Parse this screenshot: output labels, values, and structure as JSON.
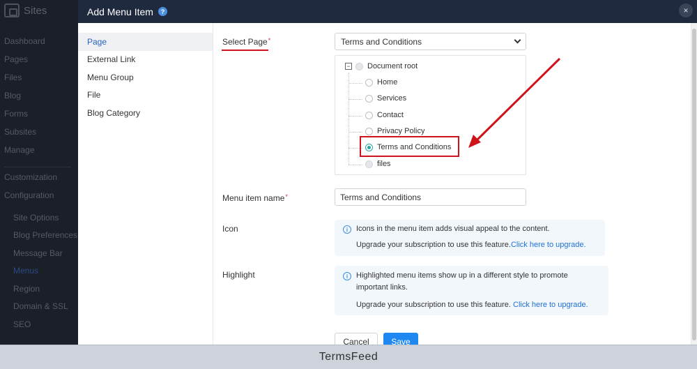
{
  "background": {
    "app_title": "Sites",
    "nav_items": [
      "Dashboard",
      "Pages",
      "Files",
      "Blog",
      "Forms",
      "Subsites",
      "Manage"
    ],
    "section_items": [
      "Customization",
      "Configuration"
    ],
    "sub_items": [
      "Site Options",
      "Blog Preferences",
      "Message Bar",
      "Menus",
      "Region",
      "Domain & SSL",
      "SEO"
    ],
    "active_sub_item": "Menus"
  },
  "modal": {
    "title": "Add Menu Item",
    "help_icon": "?",
    "close_icon": "×",
    "tabs": [
      "Page",
      "External Link",
      "Menu Group",
      "File",
      "Blog Category"
    ],
    "active_tab": "Page",
    "select_page": {
      "label": "Select Page",
      "required": "*",
      "value": "Terms and Conditions"
    },
    "tree": {
      "root": "Document root",
      "collapse_glyph": "−",
      "items": [
        "Home",
        "Services",
        "Contact",
        "Privacy Policy",
        "Terms and Conditions",
        "files"
      ],
      "selected": "Terms and Conditions"
    },
    "menu_item_name": {
      "label": "Menu item name",
      "required": "*",
      "value": "Terms and Conditions"
    },
    "icon_field": {
      "label": "Icon",
      "info": "Icons in the menu item adds visual appeal to the content.",
      "upgrade_text": "Upgrade your subscription to use this feature.",
      "upgrade_link": "Click here to upgrade."
    },
    "highlight_field": {
      "label": "Highlight",
      "info": "Highlighted menu items show up in a different style to promote important links.",
      "upgrade_text": "Upgrade your subscription to use this feature.",
      "upgrade_link": "Click here to upgrade."
    },
    "buttons": {
      "cancel": "Cancel",
      "save": "Save"
    }
  },
  "footer": {
    "brand": "TermsFeed"
  },
  "colors": {
    "annotation_red": "#d0121b",
    "accent_blue": "#1e88f0",
    "radio_selected": "#2aa6a0"
  }
}
